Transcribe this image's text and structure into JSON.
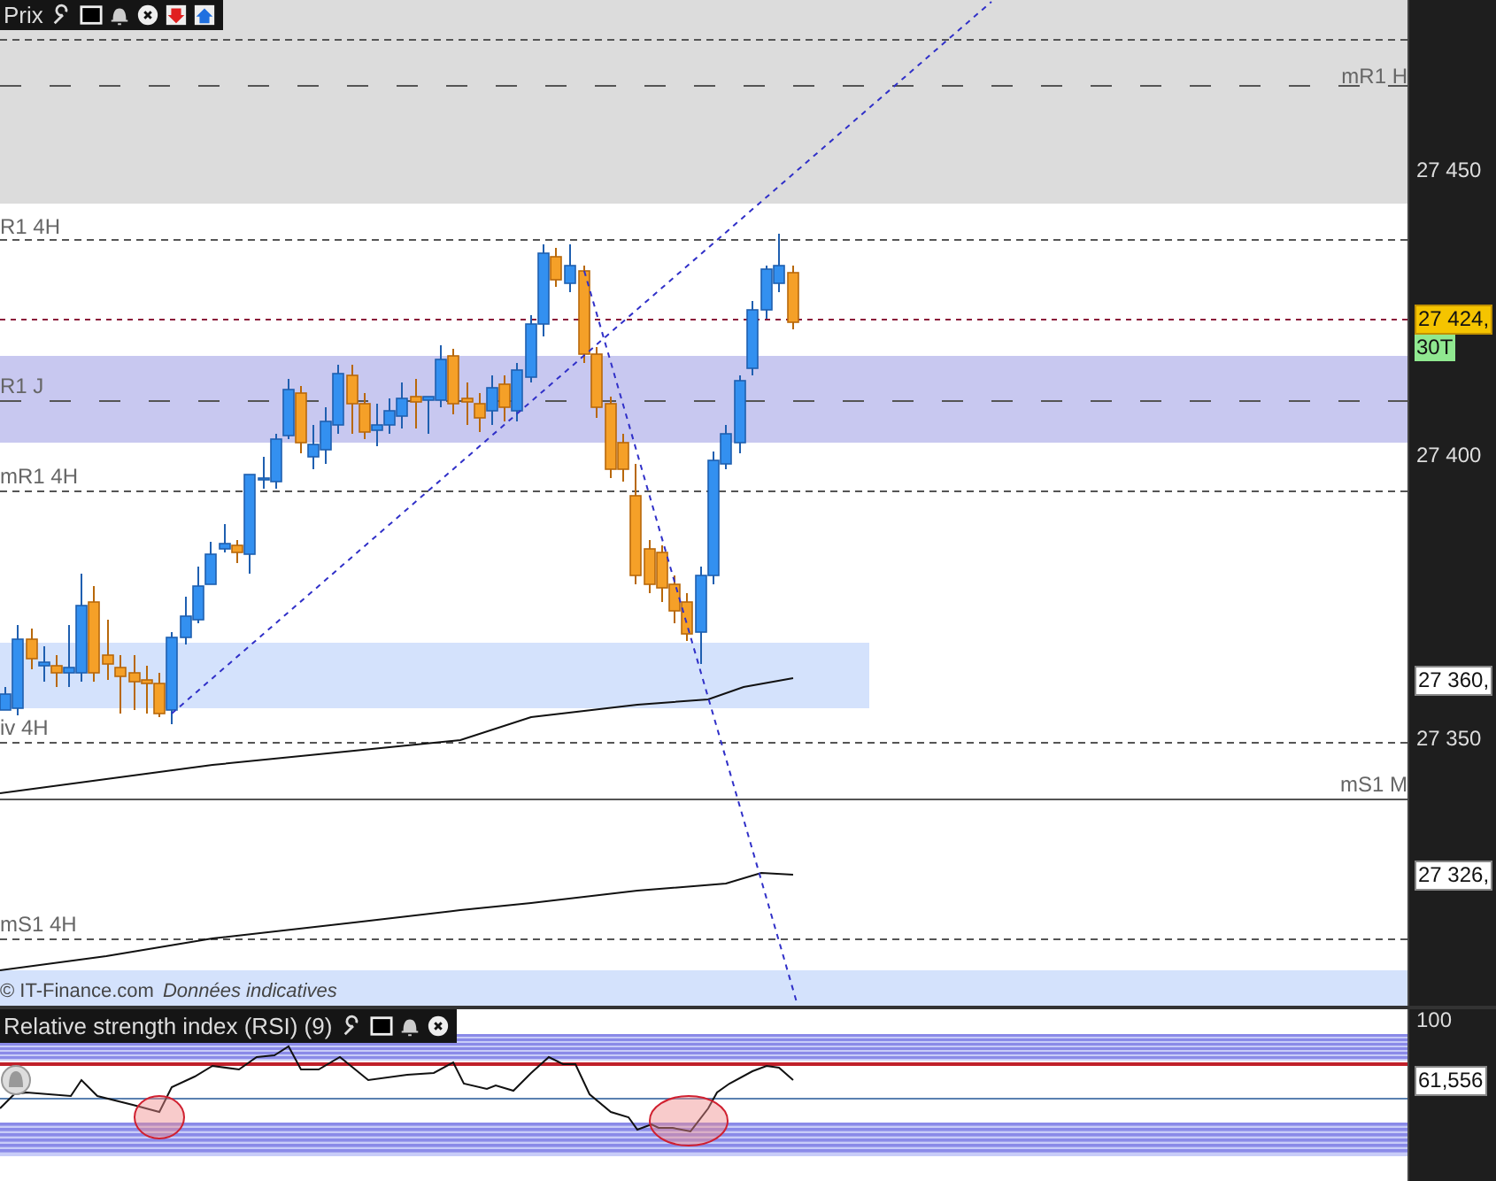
{
  "price_panel": {
    "toolbar": {
      "title": "Prix"
    },
    "level_labels": [
      {
        "text": "mR1 H",
        "kind": "right"
      },
      {
        "text": "R1 4H",
        "kind": "left"
      },
      {
        "text": "R1 J",
        "kind": "left"
      },
      {
        "text": "mR1 4H",
        "kind": "left"
      },
      {
        "text": "iv 4H",
        "kind": "left"
      },
      {
        "text": "mS1 M",
        "kind": "right"
      },
      {
        "text": "mS1 4H",
        "kind": "left"
      }
    ],
    "axis_labels": [
      {
        "text": "27 450",
        "kind": "tick"
      },
      {
        "text": "27 424,",
        "kind": "last"
      },
      {
        "text": "30T",
        "kind": "timeframe"
      },
      {
        "text": "27 400",
        "kind": "tick"
      },
      {
        "text": "27 360,",
        "kind": "value"
      },
      {
        "text": "27 350",
        "kind": "tick"
      },
      {
        "text": "27 326,",
        "kind": "value"
      }
    ],
    "footer": {
      "copyright": "© IT-Finance.com",
      "note": "Données indicatives"
    }
  },
  "rsi_panel": {
    "title": "Relative strength index (RSI) (9)",
    "axis_labels": [
      {
        "text": "100",
        "kind": "tick"
      },
      {
        "text": "61,556",
        "kind": "value"
      }
    ]
  }
}
